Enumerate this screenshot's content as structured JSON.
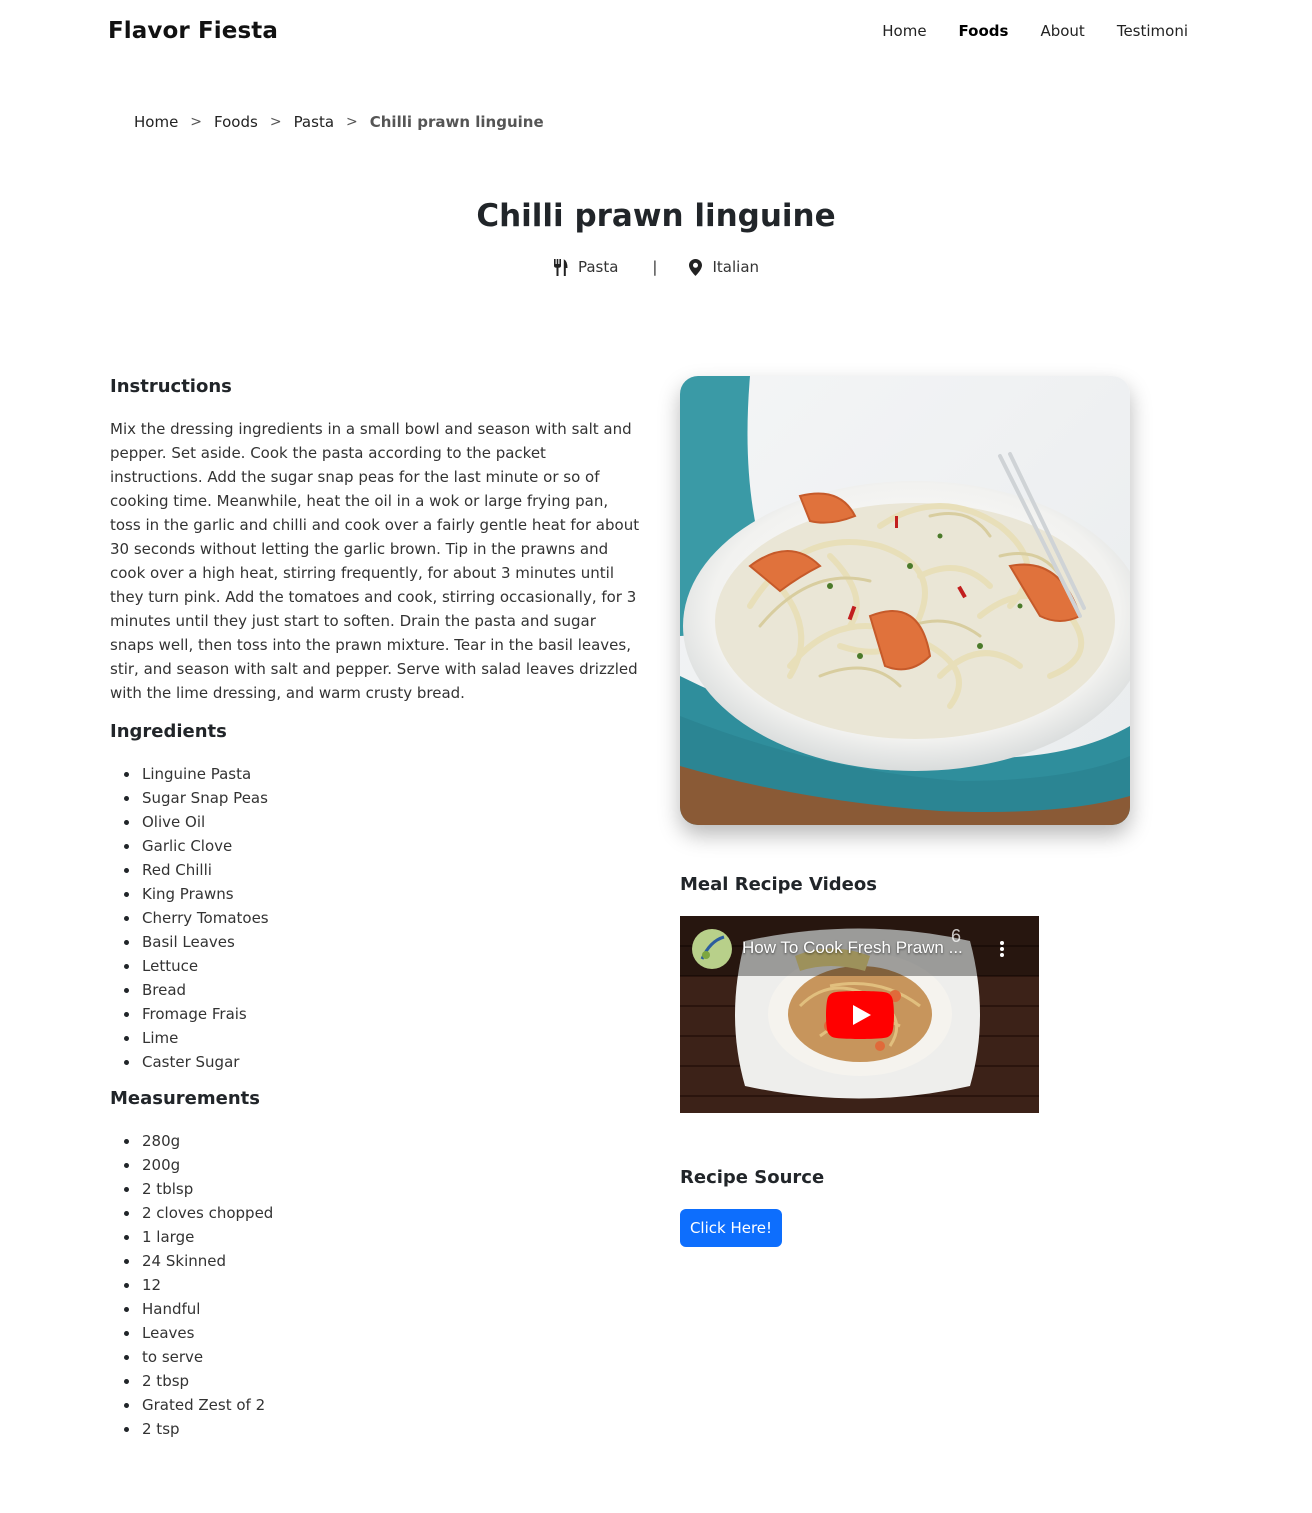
{
  "nav": {
    "brand": "Flavor Fiesta",
    "links": [
      {
        "label": "Home",
        "active": false
      },
      {
        "label": "Foods",
        "active": true
      },
      {
        "label": "About",
        "active": false
      },
      {
        "label": "Testimoni",
        "active": false
      }
    ]
  },
  "breadcrumb": {
    "items": [
      "Home",
      "Foods",
      "Pasta",
      "Chilli prawn linguine"
    ],
    "separator": ">"
  },
  "recipe": {
    "title": "Chilli prawn linguine",
    "category": "Pasta",
    "area": "Italian",
    "meta_separator": "|",
    "category_icon": "utensils-icon",
    "area_icon": "map-pin-icon"
  },
  "instructions": {
    "heading": "Instructions",
    "text": "Mix the dressing ingredients in a small bowl and season with salt and pepper. Set aside. Cook the pasta according to the packet instructions. Add the sugar snap peas for the last minute or so of cooking time. Meanwhile, heat the oil in a wok or large frying pan, toss in the garlic and chilli and cook over a fairly gentle heat for about 30 seconds without letting the garlic brown. Tip in the prawns and cook over a high heat, stirring frequently, for about 3 minutes until they turn pink. Add the tomatoes and cook, stirring occasionally, for 3 minutes until they just start to soften. Drain the pasta and sugar snaps well, then toss into the prawn mixture. Tear in the basil leaves, stir, and season with salt and pepper. Serve with salad leaves drizzled with the lime dressing, and warm crusty bread."
  },
  "ingredients": {
    "heading": "Ingredients",
    "items": [
      "Linguine Pasta",
      "Sugar Snap Peas",
      "Olive Oil",
      "Garlic Clove",
      "Red Chilli",
      "King Prawns",
      "Cherry Tomatoes",
      "Basil Leaves",
      "Lettuce",
      "Bread",
      "Fromage Frais",
      "Lime",
      "Caster Sugar"
    ]
  },
  "measurements": {
    "heading": "Measurements",
    "items": [
      "280g",
      "200g",
      "2 tblsp",
      "2 cloves chopped",
      "1 large",
      "24 Skinned",
      "12",
      "Handful",
      "Leaves",
      "to serve",
      "2 tbsp",
      "Grated Zest of 2",
      "2 tsp"
    ]
  },
  "videos": {
    "heading": "Meal Recipe Videos",
    "video_title": "How To Cook Fresh Prawn ...",
    "count": "6",
    "play_icon": "youtube-play-icon",
    "more_icon": "more-vertical-icon"
  },
  "source": {
    "heading": "Recipe Source",
    "button_label": "Click Here!"
  },
  "colors": {
    "primary_button": "#0d6efd",
    "youtube_red": "#ff0000",
    "text": "#212529"
  }
}
